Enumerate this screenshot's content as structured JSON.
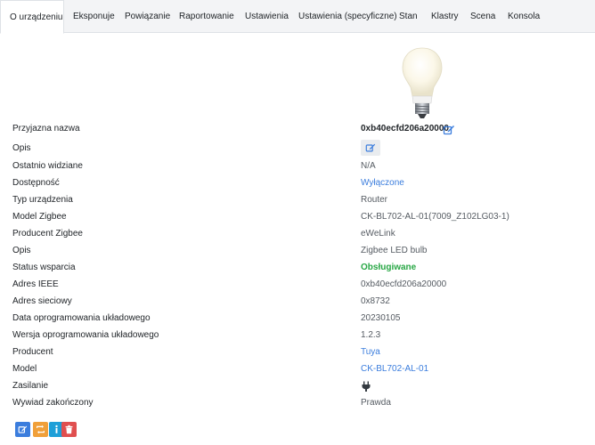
{
  "tabs": [
    {
      "label": "O urządzeniu",
      "active": true
    },
    {
      "label": "Eksponuje"
    },
    {
      "label": "Powiązanie"
    },
    {
      "label": "Raportowanie"
    },
    {
      "label": "Ustawienia"
    },
    {
      "label": "Ustawienia (specyficzne)"
    },
    {
      "label": "Stan"
    },
    {
      "label": "Klastry"
    },
    {
      "label": "Scena"
    },
    {
      "label": "Konsola"
    }
  ],
  "device": {
    "rows": [
      {
        "label": "Przyjazna nazwa",
        "value": "0xb40ecfd206a20000"
      },
      {
        "label": "Opis",
        "value": ""
      },
      {
        "label": "Ostatnio widziane",
        "value": "N/A"
      },
      {
        "label": "Dostępność",
        "value": "Wyłączone"
      },
      {
        "label": "Typ urządzenia",
        "value": "Router"
      },
      {
        "label": "Model Zigbee",
        "value": "CK-BL702-AL-01(7009_Z102LG03-1)"
      },
      {
        "label": "Producent Zigbee",
        "value": "eWeLink"
      },
      {
        "label": "Opis",
        "value": "Zigbee LED bulb"
      },
      {
        "label": "Status wsparcia",
        "value": "Obsługiwane"
      },
      {
        "label": "Adres IEEE",
        "value": "0xb40ecfd206a20000"
      },
      {
        "label": "Adres sieciowy",
        "value": "0x8732"
      },
      {
        "label": "Data oprogramowania układowego",
        "value": "20230105"
      },
      {
        "label": "Wersja oprogramowania układowego",
        "value": "1.2.3"
      },
      {
        "label": "Producent",
        "value": "Tuya"
      },
      {
        "label": "Model",
        "value": "CK-BL702-AL-01"
      },
      {
        "label": "Zasilanie",
        "value": ""
      },
      {
        "label": "Wywiad zakończony",
        "value": "Prawda"
      }
    ]
  },
  "icons": {
    "edit": "edit-icon",
    "plug": "plug-icon",
    "rename": "rename-icon",
    "reconfigure": "reconfigure-icon",
    "interview": "info-icon",
    "remove": "trash-icon"
  },
  "colors": {
    "link": "#3b7ddd",
    "supported": "#28a745",
    "btn_primary": "#3b7ddd",
    "btn_warning": "#f0a03a",
    "btn_info": "#1e9fd8",
    "btn_danger": "#e04f4f"
  }
}
